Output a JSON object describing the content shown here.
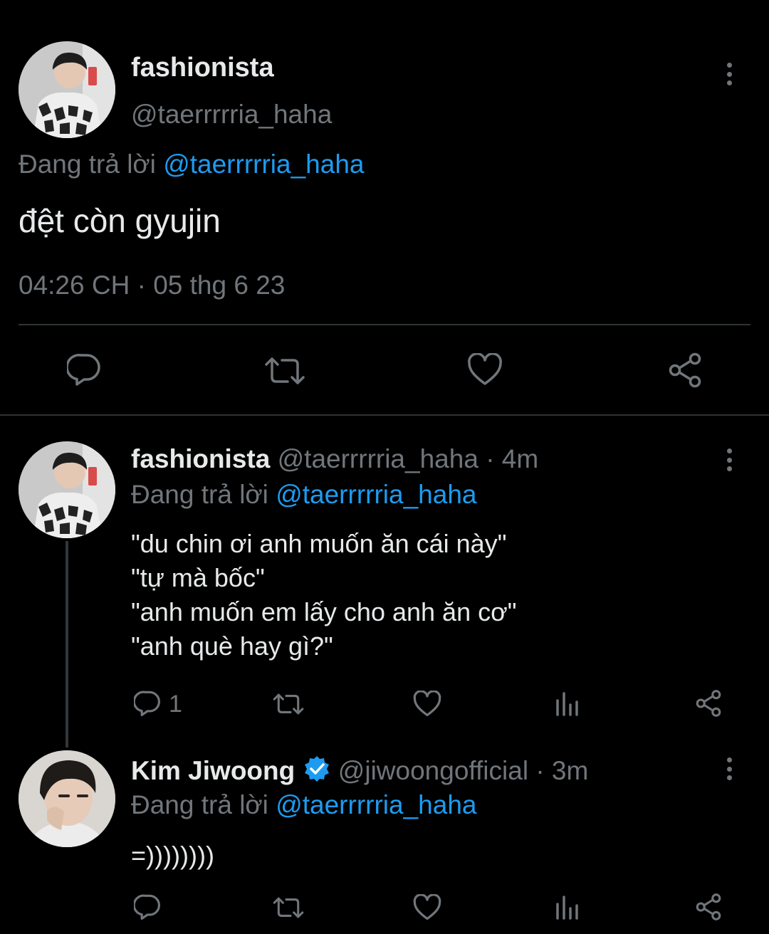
{
  "main_tweet": {
    "display_name": "fashionista",
    "handle": "@taerrrrria_haha",
    "reply_prefix": "Đang trả lời",
    "reply_to": "@taerrrrria_haha",
    "text": "đệt còn gyujin",
    "timestamp": "04:26 CH · 05 thg 6 23",
    "actions": [
      "reply-icon",
      "retweet-icon",
      "like-icon",
      "share-icon"
    ]
  },
  "replies": [
    {
      "display_name": "fashionista",
      "handle": "@taerrrrria_haha",
      "time": "· 4m",
      "reply_prefix": "Đang trả lời",
      "reply_to": "@taerrrrria_haha",
      "lines": [
        "\"du chin ơi anh muốn ăn cái này\"",
        "\"tự mà bốc\"",
        "\"anh muốn em lấy cho anh ăn cơ\"",
        "\"anh què hay gì?\""
      ],
      "reply_count": "1"
    },
    {
      "display_name": "Kim Jiwoong",
      "verified": true,
      "handle": "@jiwoongofficial",
      "time": "· 3m",
      "reply_prefix": "Đang trả lời",
      "reply_to": "@taerrrrria_haha",
      "lines": [
        "=))))))))"
      ],
      "reply_count": ""
    }
  ],
  "colors": {
    "background": "#000000",
    "text": "#e7e9ea",
    "muted": "#71767b",
    "link": "#1d9bf0",
    "verified": "#1d9bf0"
  }
}
